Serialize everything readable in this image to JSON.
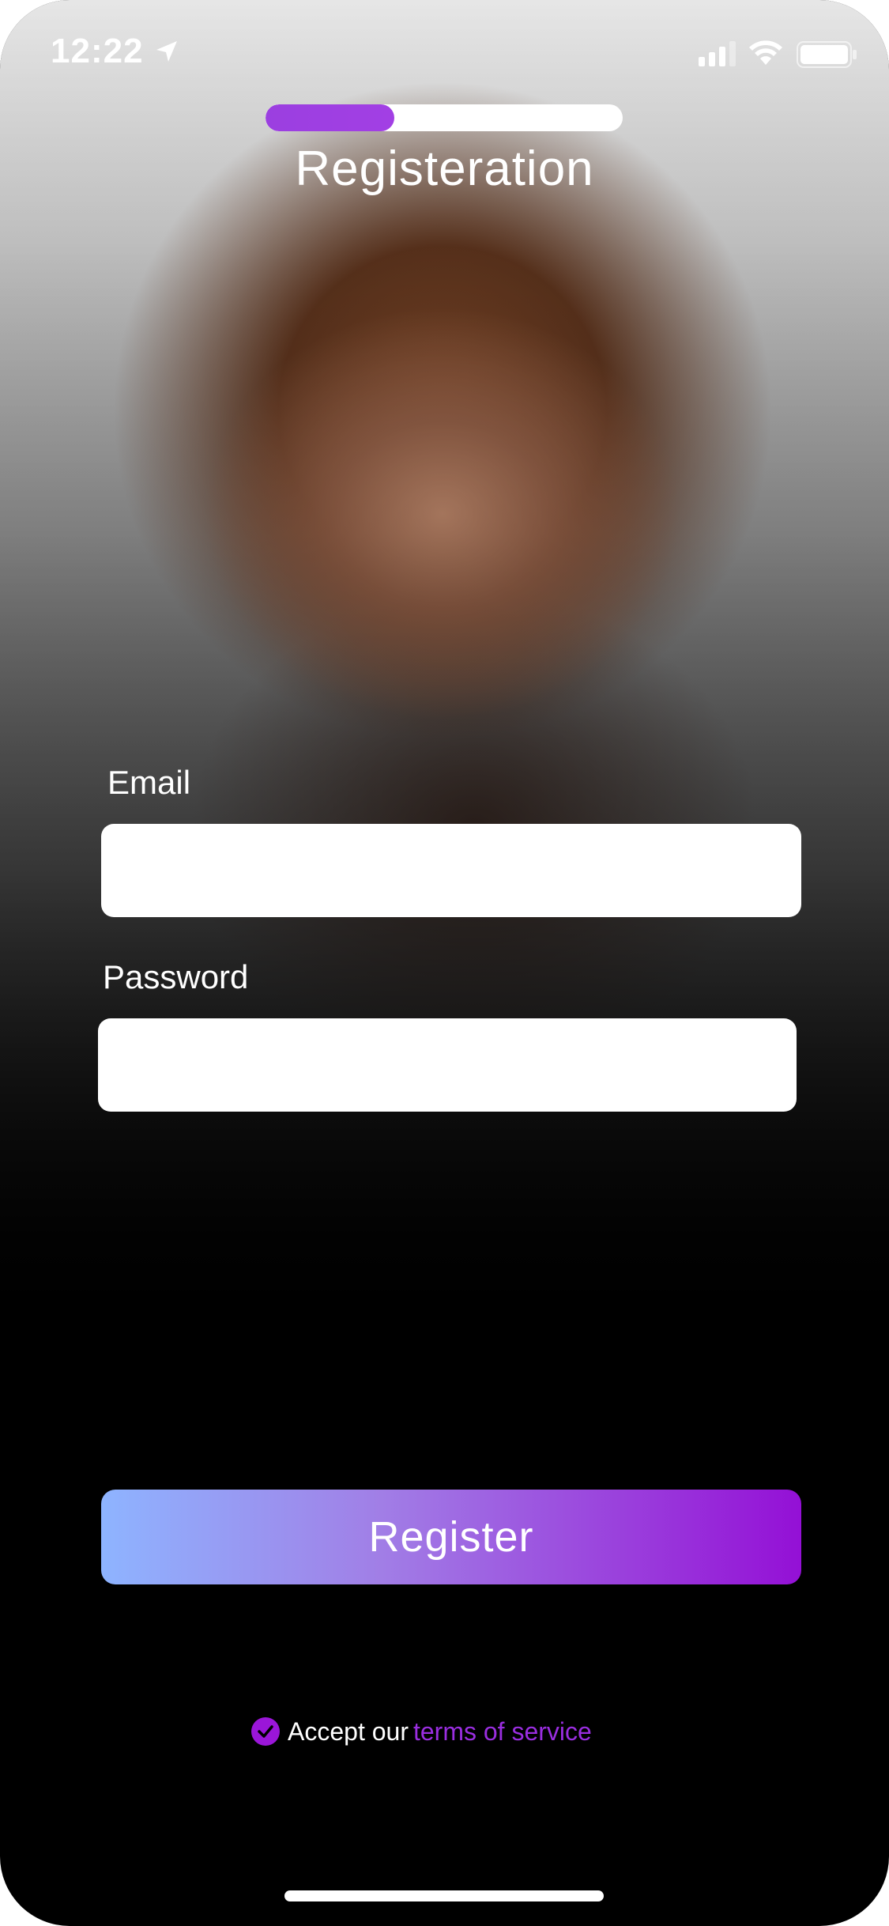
{
  "status_bar": {
    "time": "12:22",
    "location_icon": "location-arrow-icon",
    "signal_icon": "cellular-signal-icon",
    "wifi_icon": "wifi-icon",
    "battery_icon": "battery-icon"
  },
  "progress": {
    "fraction": 0.36,
    "color": "#9b3fe0"
  },
  "header": {
    "title": "Registeration"
  },
  "form": {
    "email_label": "Email",
    "email_value": "",
    "password_label": "Password",
    "password_value": ""
  },
  "register_button": {
    "label": "Register",
    "gradient_start": "#8eb4ff",
    "gradient_end": "#9410d6"
  },
  "terms": {
    "check_icon": "check-circle-icon",
    "accept_text": "Accept our",
    "link_text": "terms of service",
    "link_color": "#9a2ee0"
  }
}
